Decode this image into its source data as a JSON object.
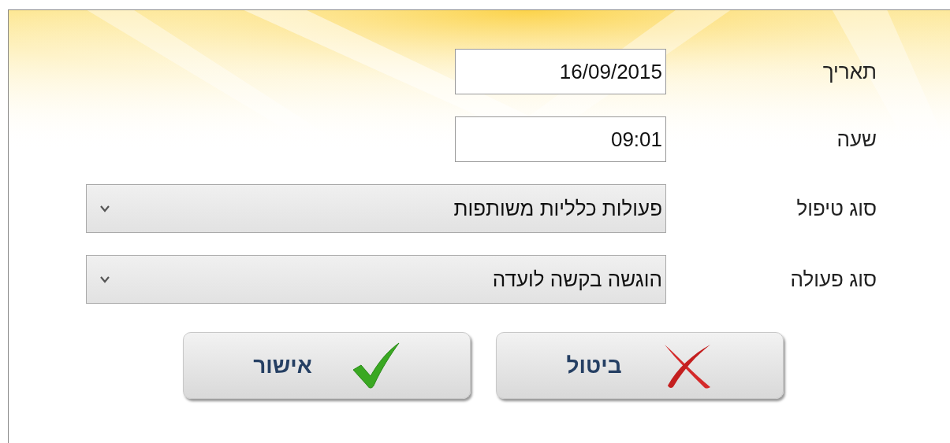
{
  "fields": [
    {
      "label": "תאריך",
      "kind": "text",
      "value": "16/09/2015"
    },
    {
      "label": "שעה",
      "kind": "text",
      "value": "09:01"
    },
    {
      "label": "סוג טיפול",
      "kind": "select",
      "value": "פעולות כלליות משותפות"
    },
    {
      "label": "סוג פעולה",
      "kind": "select",
      "value": "הוגשה בקשה לועדה"
    }
  ],
  "buttons": [
    {
      "label": "ביטול",
      "kind": "cancel"
    },
    {
      "label": "אישור",
      "kind": "confirm"
    }
  ]
}
